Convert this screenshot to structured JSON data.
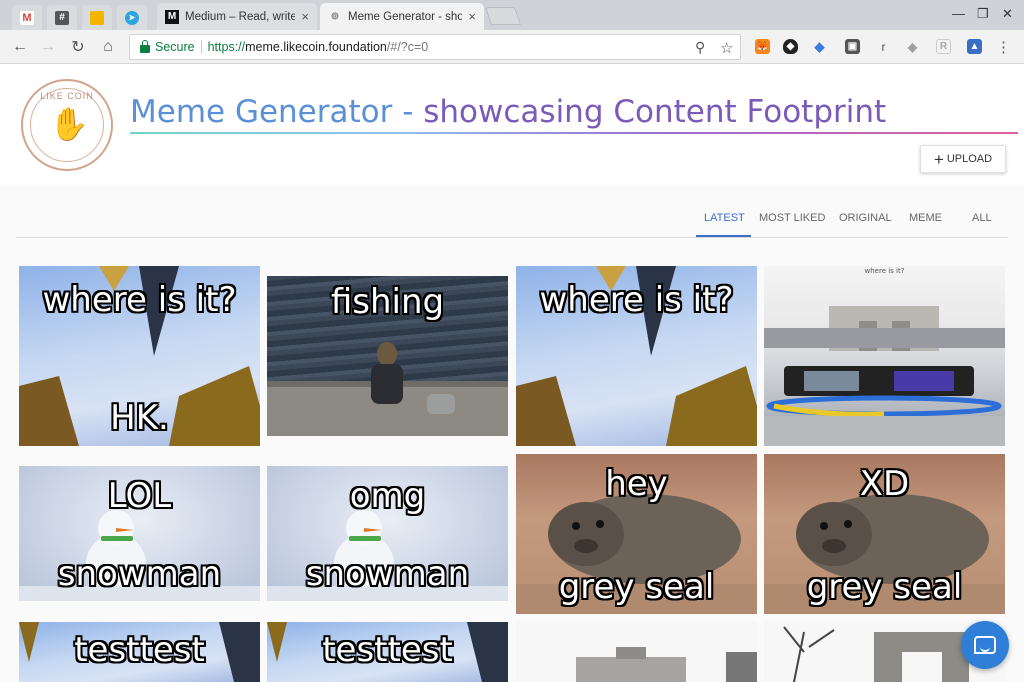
{
  "browser": {
    "pinned_tabs": [
      {
        "name": "gmail-tab",
        "glyph": "M",
        "color": "#d44638"
      },
      {
        "name": "slack-tab",
        "glyph": "#",
        "color": "#555555"
      },
      {
        "name": "keep-tab",
        "glyph": "",
        "color": "#f4b400"
      },
      {
        "name": "telegram-tab",
        "glyph": "➤",
        "color": "#2ca5e0"
      }
    ],
    "tabs": [
      {
        "title": "Medium – Read, write and share stories",
        "favicon": "M"
      },
      {
        "title": "Meme Generator - showcasing Content Footprint",
        "favicon": "⊚"
      }
    ],
    "close_glyph": "×",
    "window_controls": {
      "minimize": "—",
      "maximize": "❐",
      "close": "✕"
    },
    "nav": {
      "back": "←",
      "forward": "→",
      "reload": "↻",
      "home": "⌂"
    },
    "url": {
      "secure_label": "Secure",
      "scheme": "https://",
      "host": "meme.likecoin.foundation",
      "path": "/#/?c=0"
    },
    "omnibox_icons": {
      "zoom": "⚲",
      "star": "☆"
    },
    "extensions": [
      {
        "name": "metamask-icon",
        "glyph": "🦊",
        "bg": "#f6851b"
      },
      {
        "name": "shield-dark-icon",
        "glyph": "◆",
        "bg": "#222222"
      },
      {
        "name": "ethereum-icon",
        "glyph": "◆",
        "bg": "#3c7be0"
      },
      {
        "name": "vault-icon",
        "glyph": "▣",
        "bg": "#555555"
      },
      {
        "name": "r-icon",
        "glyph": "r",
        "bg": "#f2f2f2"
      },
      {
        "name": "privacy-badger-icon",
        "glyph": "◈",
        "bg": "#bbbbbb"
      },
      {
        "name": "readability-icon",
        "glyph": "R",
        "bg": "#dddddd"
      },
      {
        "name": "photo-icon",
        "glyph": "▲",
        "bg": "#3a6ec6"
      },
      {
        "name": "menu-icon",
        "glyph": "⋮",
        "bg": "#f2f2f2"
      }
    ]
  },
  "app": {
    "logo_text": "LIKE COIN",
    "logo_glyph": "✋",
    "title_part1": "Meme Generator -",
    "title_part2": " showcasing Content Footprint",
    "upload_plus": "+",
    "upload_label": "UPLOAD",
    "filter_tabs": [
      "LATEST",
      "MOST LIKED",
      "ORIGINAL",
      "MEME",
      "ALL"
    ],
    "active_filter": "LATEST"
  },
  "memes": [
    {
      "top": "where is it?",
      "bottom": "HK.",
      "scene": "city"
    },
    {
      "top": "fishing",
      "bottom": "",
      "scene": "pier"
    },
    {
      "top": "where is it?",
      "bottom": "",
      "scene": "city"
    },
    {
      "top": "where is it?",
      "bottom": "",
      "scene": "plaza"
    },
    {
      "top": "LOL",
      "bottom": "snowman",
      "scene": "snow"
    },
    {
      "top": "omg",
      "bottom": "snowman",
      "scene": "snow"
    },
    {
      "top": "hey",
      "bottom": "grey seal",
      "scene": "seal"
    },
    {
      "top": "XD",
      "bottom": "grey seal",
      "scene": "seal"
    },
    {
      "top": "testtest",
      "bottom": "",
      "scene": "city"
    },
    {
      "top": "testtest",
      "bottom": "",
      "scene": "city"
    },
    {
      "top": "",
      "bottom": "",
      "scene": "arch"
    },
    {
      "top": "",
      "bottom": "",
      "scene": "arch2"
    }
  ]
}
